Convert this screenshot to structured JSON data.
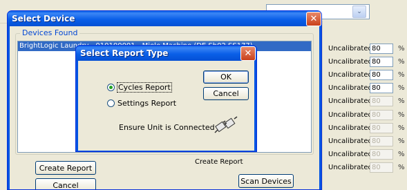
{
  "background": {
    "combo_arrow": "⌄",
    "calibration_rows": [
      {
        "label": "Uncalibrated",
        "value": "80",
        "enabled": true
      },
      {
        "label": "Uncalibrated",
        "value": "80",
        "enabled": true
      },
      {
        "label": "Uncalibrated",
        "value": "80",
        "enabled": true
      },
      {
        "label": "Uncalibrated",
        "value": "80",
        "enabled": true
      },
      {
        "label": "Uncalibrated",
        "value": "80",
        "enabled": false
      },
      {
        "label": "Uncalibrated",
        "value": "80",
        "enabled": false
      },
      {
        "label": "Uncalibrated",
        "value": "80",
        "enabled": false
      },
      {
        "label": "Uncalibrated",
        "value": "80",
        "enabled": false
      },
      {
        "label": "Uncalibrated",
        "value": "80",
        "enabled": false
      },
      {
        "label": "Uncalibrated",
        "value": "80",
        "enabled": false
      }
    ],
    "row_mark": "%"
  },
  "select_device": {
    "title": "Select Device",
    "close_glyph": "✕",
    "group_label": "Devices Found",
    "selected_item": "BrightLogic Laundry - 010100001 - Miele Machine (DE Sh02 SS177)",
    "create_report_label": "Create Report",
    "create_report_ghost": "Create Report",
    "cancel_label": "Cancel",
    "scan_devices_label": "Scan Devices"
  },
  "report_type": {
    "title": "Select Report Type",
    "close_glyph": "✕",
    "ok_label": "OK",
    "cancel_label": "Cancel",
    "option_cycles": "Cycles Report",
    "option_settings": "Settings Report",
    "selected_option": "cycles",
    "status_text": "Ensure Unit is Connected",
    "icon": "connector-plug-icon"
  },
  "colors": {
    "title_blue": "#0a5fe8",
    "selection_blue": "#316ac5",
    "close_red": "#c9401b",
    "dialog_face": "#ece9d8"
  }
}
